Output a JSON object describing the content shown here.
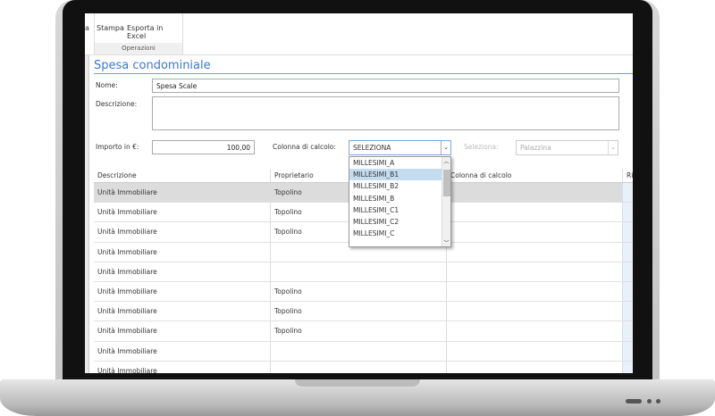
{
  "ribbon": {
    "partial_button": "a",
    "buttons": [
      "Stampa",
      "Esporta in Excel"
    ],
    "group_label": "Operazioni"
  },
  "form": {
    "title": "Spesa condominiale",
    "nome_label": "Nome:",
    "nome_value": "Spesa Scale",
    "descrizione_label": "Descrizione:",
    "descrizione_value": "",
    "importo_label": "Importo in €:",
    "importo_value": "100,00",
    "colonna_label": "Colonna di calcolo:",
    "colonna_value": "SELEZIONA",
    "seleziona_label": "Seleziona:",
    "seleziona_value": "Palazzina",
    "dropdown_options": [
      "MILLESIMI_A",
      "MILLESIMI_B1",
      "MILLESIMI_B2",
      "MILLESIMI_B",
      "MILLESIMI_C1",
      "MILLESIMI_C2",
      "MILLESIMI_C"
    ],
    "dropdown_highlighted": "MILLESIMI_B1"
  },
  "grid": {
    "columns": [
      "Descrizione",
      "Proprietario",
      "Colonna di calcolo",
      "Ri"
    ],
    "rows": [
      [
        "Unità Immobiliare",
        "Topolino",
        ""
      ],
      [
        "Unità Immobiliare",
        "Topolino",
        ""
      ],
      [
        "Unità Immobiliare",
        "Topolino",
        ""
      ],
      [
        "Unità Immobiliare",
        "",
        ""
      ],
      [
        "Unità Immobiliare",
        "",
        ""
      ],
      [
        "Unità Immobiliare",
        "Topolino",
        ""
      ],
      [
        "Unità Immobiliare",
        "Topolino",
        ""
      ],
      [
        "Unità Immobiliare",
        "Topolino",
        ""
      ],
      [
        "Unità Immobiliare",
        "",
        ""
      ],
      [
        "Unità Immobiliare",
        "",
        ""
      ]
    ]
  },
  "colors": {
    "accent": "#3a78d6",
    "selected_row": "#dcdcdc",
    "dropdown_highlight": "#c4dcf0"
  }
}
